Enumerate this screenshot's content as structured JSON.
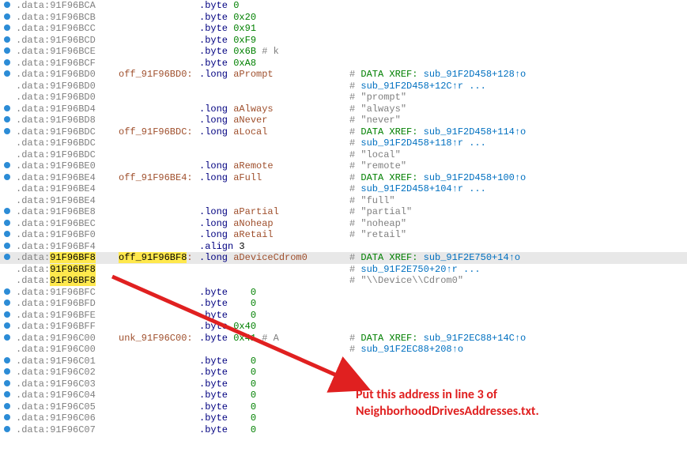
{
  "lines": [
    {
      "bp": true,
      "seg": ".data",
      "addr": "91F96BCA",
      "label": "",
      "instr_kw": ".byte",
      "instr_arg_num": "0",
      "cmt": ""
    },
    {
      "bp": true,
      "seg": ".data",
      "addr": "91F96BCB",
      "label": "",
      "instr_kw": ".byte",
      "instr_arg_num": "0x20",
      "cmt": ""
    },
    {
      "bp": true,
      "seg": ".data",
      "addr": "91F96BCC",
      "label": "",
      "instr_kw": ".byte",
      "instr_arg_num": "0x91",
      "cmt": ""
    },
    {
      "bp": true,
      "seg": ".data",
      "addr": "91F96BCD",
      "label": "",
      "instr_kw": ".byte",
      "instr_arg_num": "0xF9",
      "cmt": ""
    },
    {
      "bp": true,
      "seg": ".data",
      "addr": "91F96BCE",
      "label": "",
      "instr_kw": ".byte",
      "instr_arg_num": "0x6B",
      "suffix": " # k",
      "cmt": ""
    },
    {
      "bp": true,
      "seg": ".data",
      "addr": "91F96BCF",
      "label": "",
      "instr_kw": ".byte",
      "instr_arg_num": "0xA8",
      "cmt": ""
    },
    {
      "bp": true,
      "seg": ".data",
      "addr": "91F96BD0",
      "label": "off_91F96BD0:",
      "instr_kw": ".long",
      "instr_arg_id": "aPrompt",
      "cmt_xref": "DATA XREF: ",
      "cmt_route": "sub_91F2D458+128↑o"
    },
    {
      "bp": false,
      "seg": ".data",
      "addr": "91F96BD0",
      "label": "",
      "instr_kw": "",
      "cmt_route2": "sub_91F2D458+12C↑r ..."
    },
    {
      "bp": false,
      "seg": ".data",
      "addr": "91F96BD0",
      "label": "",
      "instr_kw": "",
      "cmt_str": "\"prompt\""
    },
    {
      "bp": true,
      "seg": ".data",
      "addr": "91F96BD4",
      "label": "",
      "instr_kw": ".long",
      "instr_arg_id": "aAlways",
      "cmt_str": "\"always\""
    },
    {
      "bp": true,
      "seg": ".data",
      "addr": "91F96BD8",
      "label": "",
      "instr_kw": ".long",
      "instr_arg_id": "aNever",
      "cmt_str": "\"never\""
    },
    {
      "bp": true,
      "seg": ".data",
      "addr": "91F96BDC",
      "label": "off_91F96BDC:",
      "instr_kw": ".long",
      "instr_arg_id": "aLocal",
      "cmt_xref": "DATA XREF: ",
      "cmt_route": "sub_91F2D458+114↑o"
    },
    {
      "bp": false,
      "seg": ".data",
      "addr": "91F96BDC",
      "label": "",
      "instr_kw": "",
      "cmt_route2": "sub_91F2D458+118↑r ..."
    },
    {
      "bp": false,
      "seg": ".data",
      "addr": "91F96BDC",
      "label": "",
      "instr_kw": "",
      "cmt_str": "\"local\""
    },
    {
      "bp": true,
      "seg": ".data",
      "addr": "91F96BE0",
      "label": "",
      "instr_kw": ".long",
      "instr_arg_id": "aRemote",
      "cmt_str": "\"remote\""
    },
    {
      "bp": true,
      "seg": ".data",
      "addr": "91F96BE4",
      "label": "off_91F96BE4:",
      "instr_kw": ".long",
      "instr_arg_id": "aFull",
      "cmt_xref": "DATA XREF: ",
      "cmt_route": "sub_91F2D458+100↑o"
    },
    {
      "bp": false,
      "seg": ".data",
      "addr": "91F96BE4",
      "label": "",
      "instr_kw": "",
      "cmt_route2": "sub_91F2D458+104↑r ..."
    },
    {
      "bp": false,
      "seg": ".data",
      "addr": "91F96BE4",
      "label": "",
      "instr_kw": "",
      "cmt_str": "\"full\""
    },
    {
      "bp": true,
      "seg": ".data",
      "addr": "91F96BE8",
      "label": "",
      "instr_kw": ".long",
      "instr_arg_id": "aPartial",
      "cmt_str": "\"partial\""
    },
    {
      "bp": true,
      "seg": ".data",
      "addr": "91F96BEC",
      "label": "",
      "instr_kw": ".long",
      "instr_arg_id": "aNoheap",
      "cmt_str": "\"noheap\""
    },
    {
      "bp": true,
      "seg": ".data",
      "addr": "91F96BF0",
      "label": "",
      "instr_kw": ".long",
      "instr_arg_id": "aRetail",
      "cmt_str": "\"retail\""
    },
    {
      "bp": true,
      "seg": ".data",
      "addr": "91F96BF4",
      "label": "",
      "instr_kw": ".align",
      "instr_arg_plain": "3",
      "cmt": ""
    },
    {
      "bp": true,
      "sel": true,
      "seg": ".data",
      "addr": "91F96BF8",
      "addr_hl": true,
      "label": "off_91F96BF8",
      "label_hl": true,
      "instr_kw": ".long",
      "instr_arg_id": "aDeviceCdrom0",
      "cmt_xref": "DATA XREF: ",
      "cmt_route": "sub_91F2E750+14↑o"
    },
    {
      "bp": false,
      "seg": ".data",
      "addr": "91F96BF8",
      "addr_hl": true,
      "label": "",
      "instr_kw": "",
      "cmt_route2": "sub_91F2E750+20↑r ..."
    },
    {
      "bp": false,
      "seg": ".data",
      "addr": "91F96BF8",
      "addr_hl": true,
      "label": "",
      "instr_kw": "",
      "cmt_str": "\"\\\\Device\\\\Cdrom0\""
    },
    {
      "bp": true,
      "seg": ".data",
      "addr": "91F96BFC",
      "label": "",
      "instr_kw": ".byte",
      "instr_arg_num_pad": "   0",
      "cmt": ""
    },
    {
      "bp": true,
      "seg": ".data",
      "addr": "91F96BFD",
      "label": "",
      "instr_kw": ".byte",
      "instr_arg_num_pad": "   0",
      "cmt": ""
    },
    {
      "bp": true,
      "seg": ".data",
      "addr": "91F96BFE",
      "label": "",
      "instr_kw": ".byte",
      "instr_arg_num_pad": "   0",
      "cmt": ""
    },
    {
      "bp": true,
      "seg": ".data",
      "addr": "91F96BFF",
      "label": "",
      "instr_kw": ".byte",
      "instr_arg_num_pad": "0x40",
      "cmt": ""
    },
    {
      "bp": true,
      "seg": ".data",
      "addr": "91F96C00",
      "label": "unk_91F96C00:",
      "instr_kw": ".byte",
      "instr_arg_num": "0x41",
      "suffix": " # A",
      "cmt_xref": "DATA XREF: ",
      "cmt_route": "sub_91F2EC88+14C↑o"
    },
    {
      "bp": false,
      "seg": ".data",
      "addr": "91F96C00",
      "label": "",
      "instr_kw": "",
      "cmt_route2": "sub_91F2EC88+208↑o"
    },
    {
      "bp": true,
      "seg": ".data",
      "addr": "91F96C01",
      "label": "",
      "instr_kw": ".byte",
      "instr_arg_num_pad": "   0",
      "cmt": ""
    },
    {
      "bp": true,
      "seg": ".data",
      "addr": "91F96C02",
      "label": "",
      "instr_kw": ".byte",
      "instr_arg_num_pad": "   0",
      "cmt": ""
    },
    {
      "bp": true,
      "seg": ".data",
      "addr": "91F96C03",
      "label": "",
      "instr_kw": ".byte",
      "instr_arg_num_pad": "   0",
      "cmt": ""
    },
    {
      "bp": true,
      "seg": ".data",
      "addr": "91F96C04",
      "label": "",
      "instr_kw": ".byte",
      "instr_arg_num_pad": "   0",
      "cmt": ""
    },
    {
      "bp": true,
      "seg": ".data",
      "addr": "91F96C05",
      "label": "",
      "instr_kw": ".byte",
      "instr_arg_num_pad": "   0",
      "cmt": ""
    },
    {
      "bp": true,
      "seg": ".data",
      "addr": "91F96C06",
      "label": "",
      "instr_kw": ".byte",
      "instr_arg_num_pad": "   0",
      "cmt": ""
    },
    {
      "bp": true,
      "seg": ".data",
      "addr": "91F96C07",
      "label": "",
      "instr_kw": ".byte",
      "instr_arg_num_pad": "   0",
      "cmt": ""
    }
  ],
  "annotation": {
    "line1": "Put this address in line 3 of",
    "line2": "NeighborhoodDrivesAddresses.txt."
  }
}
